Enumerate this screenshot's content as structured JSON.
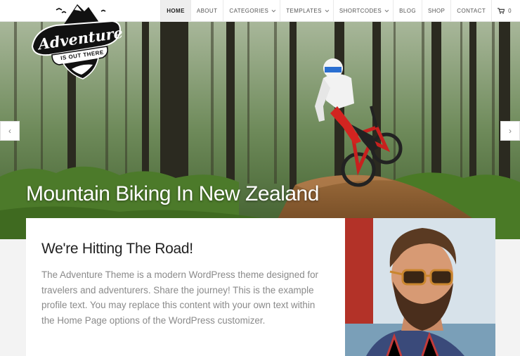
{
  "nav": {
    "items": [
      {
        "label": "Home",
        "active": true,
        "dropdown": false
      },
      {
        "label": "About",
        "active": false,
        "dropdown": false
      },
      {
        "label": "Categories",
        "active": false,
        "dropdown": true
      },
      {
        "label": "Templates",
        "active": false,
        "dropdown": true
      },
      {
        "label": "Shortcodes",
        "active": false,
        "dropdown": true
      },
      {
        "label": "Blog",
        "active": false,
        "dropdown": false
      },
      {
        "label": "Shop",
        "active": false,
        "dropdown": false
      },
      {
        "label": "Contact",
        "active": false,
        "dropdown": false
      }
    ],
    "cart_count": "0",
    "cart_icon": "cart-icon"
  },
  "logo": {
    "main": "Adventure",
    "sub": "IS OUT THERE",
    "icon": "mountain-logo"
  },
  "hero": {
    "title": "Mountain Biking In New Zealand",
    "prev_arrow": "‹",
    "next_arrow": "›"
  },
  "profile": {
    "title": "We're Hitting The Road!",
    "text": "The Adventure Theme is a modern WordPress theme designed for travelers and adventurers. Share the journey! This is the example profile text. You may replace this content with your own text within the Home Page options of the WordPress customizer."
  },
  "colors": {
    "header_bg": "#ffffff",
    "nav_active_bg": "#eeeeee",
    "card_bg": "#ffffff",
    "text_gray": "#8a8a8a"
  }
}
